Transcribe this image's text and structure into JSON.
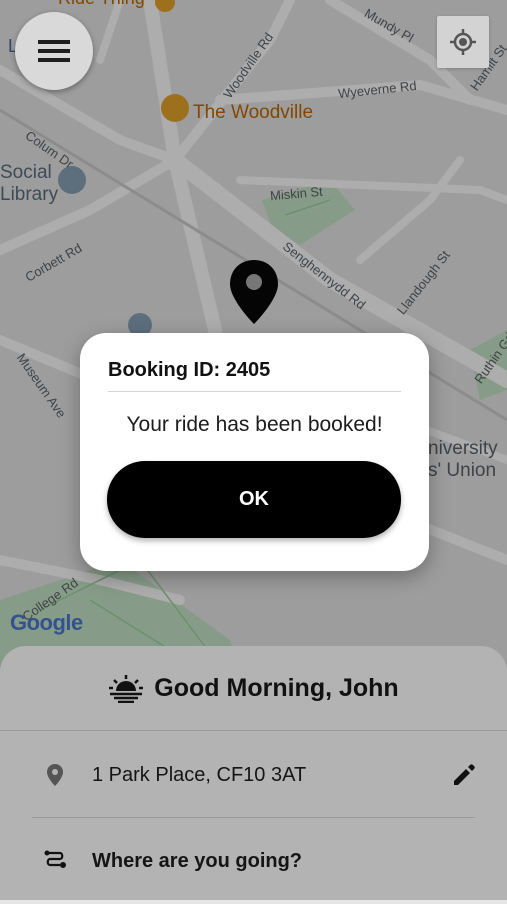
{
  "map": {
    "labels": {
      "ride_thing": "Ride Thing",
      "mundy_pl": "Mundy Pl",
      "woodville_rd": "Woodville Rd",
      "wyeverne_rd": "Wyeverne Rd",
      "hamilt_st": "Hamilt St",
      "the_woodville": "The Woodville",
      "colum_dr": "Colum Dr",
      "social_library_1": "Social",
      "social_library_2": "Library",
      "miskin_st": "Miskin St",
      "corbett_rd": "Corbett Rd",
      "senghennydd_rd": "Senghennydd Rd",
      "llandough_st": "Llandough St",
      "ruthin_gdns": "Ruthin Gdns",
      "museum_ave": "Museum Ave",
      "university_1": "niversity",
      "university_2": "s' Union",
      "college_rd": "College Rd",
      "l_fragment": "L"
    },
    "google_logo": "Google"
  },
  "header": {
    "menu_icon": "hamburger-menu-icon",
    "location_icon": "my-location-icon"
  },
  "dialog": {
    "title": "Booking ID: 2405",
    "message": "Your ride has been booked!",
    "ok_label": "OK"
  },
  "sheet": {
    "greeting": "Good Morning, John",
    "greeting_icon": "sunrise-icon",
    "pickup": "1 Park Place, CF10 3AT",
    "pickup_icon": "location-pin-icon",
    "edit_icon": "pencil-icon",
    "destination_placeholder": "Where are you going?",
    "destination_icon": "route-icon"
  }
}
